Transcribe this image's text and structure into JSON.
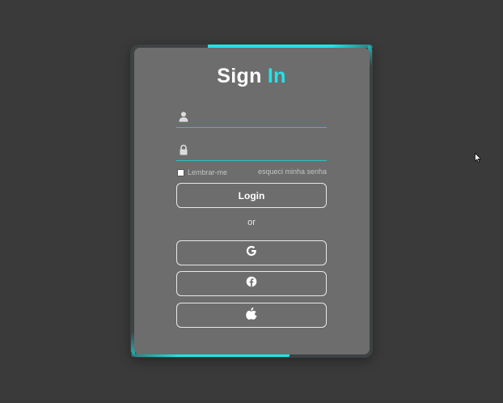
{
  "title": {
    "part1": "Sign ",
    "part2": "In"
  },
  "form": {
    "username": {
      "placeholder": "",
      "value": "",
      "icon": "user-icon"
    },
    "password": {
      "placeholder": "",
      "value": "",
      "icon": "lock-icon"
    },
    "remember_label": "Lembrar-me",
    "remember_checked": false,
    "forgot_label": "esqueci minha senha",
    "login_label": "Login",
    "or_label": "or"
  },
  "social": [
    {
      "name": "google",
      "icon": "google-icon"
    },
    {
      "name": "facebook",
      "icon": "facebook-icon"
    },
    {
      "name": "apple",
      "icon": "apple-icon"
    }
  ],
  "colors": {
    "background": "#3a3a3a",
    "card": "#6d6d6d",
    "accent": "#22e3ea",
    "text": "#ffffff"
  }
}
